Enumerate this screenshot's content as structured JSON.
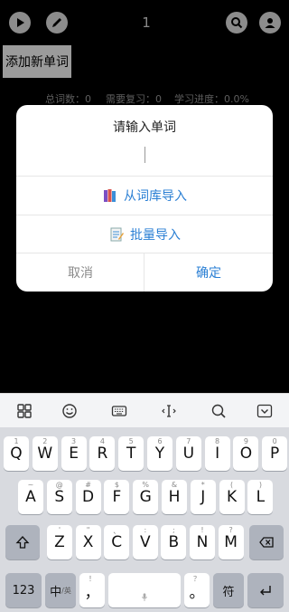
{
  "topbar": {
    "page_number": "1"
  },
  "add_button": "添加新单词",
  "stats": {
    "total": "总词数：0",
    "review": "需要复习：0",
    "progress": "学习进度：0.0%"
  },
  "dialog": {
    "title": "请输入单词",
    "input_value": "",
    "import_library": "从词库导入",
    "batch_import": "批量导入",
    "cancel": "取消",
    "confirm": "确定"
  },
  "keyboard": {
    "row1": [
      {
        "main": "Q",
        "sub": "1"
      },
      {
        "main": "W",
        "sub": "2"
      },
      {
        "main": "E",
        "sub": "3"
      },
      {
        "main": "R",
        "sub": "4"
      },
      {
        "main": "T",
        "sub": "5"
      },
      {
        "main": "Y",
        "sub": "6"
      },
      {
        "main": "U",
        "sub": "7"
      },
      {
        "main": "I",
        "sub": "8"
      },
      {
        "main": "O",
        "sub": "9"
      },
      {
        "main": "P",
        "sub": "0"
      }
    ],
    "row2": [
      {
        "main": "A",
        "sub": "~"
      },
      {
        "main": "S",
        "sub": "@"
      },
      {
        "main": "D",
        "sub": "#"
      },
      {
        "main": "F",
        "sub": "$"
      },
      {
        "main": "G",
        "sub": "%"
      },
      {
        "main": "H",
        "sub": "&"
      },
      {
        "main": "J",
        "sub": "*"
      },
      {
        "main": "K",
        "sub": "("
      },
      {
        "main": "L",
        "sub": ")"
      }
    ],
    "row3": [
      {
        "main": "Z",
        "sub": "'"
      },
      {
        "main": "X",
        "sub": "\""
      },
      {
        "main": "C",
        "sub": "、"
      },
      {
        "main": "V",
        "sub": ":"
      },
      {
        "main": "B",
        "sub": ";"
      },
      {
        "main": "N",
        "sub": "!"
      },
      {
        "main": "M",
        "sub": "?"
      }
    ],
    "num_key": "123",
    "lang_key": "中",
    "lang_key_sub": "/英",
    "comma_key": "，",
    "comma_sub": "！",
    "period_key": "。",
    "period_sub": "？",
    "symbol_key": "符"
  },
  "colors": {
    "accent": "#2a7fd4",
    "background": "#000000",
    "dialog": "#ffffff",
    "keyboard": "#d8dadf"
  }
}
